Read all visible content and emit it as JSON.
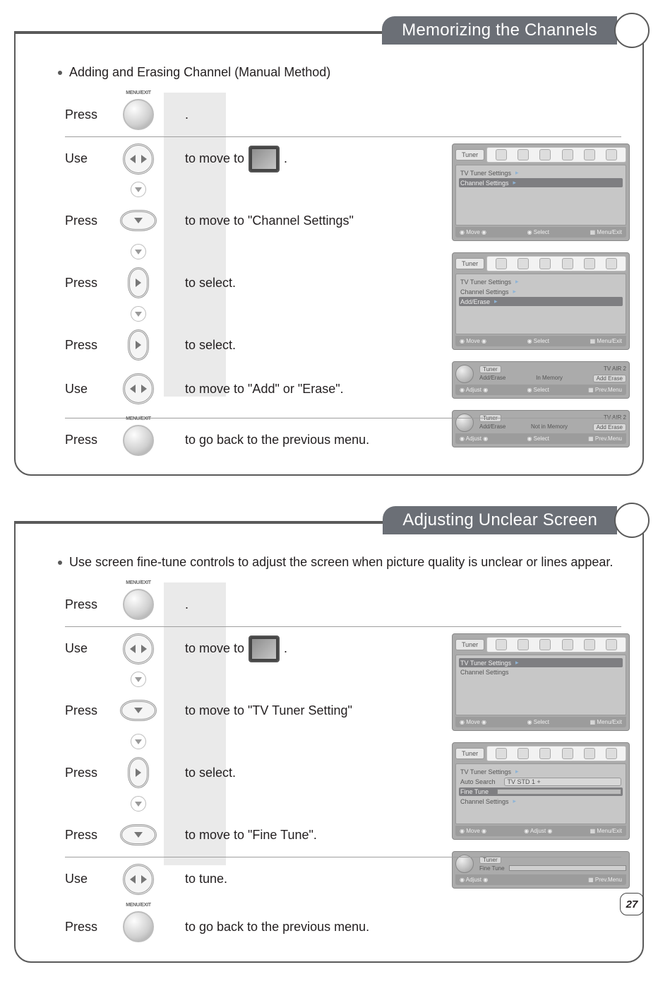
{
  "page_number": "27",
  "section1": {
    "header": "Memorizing the Channels",
    "title": "Adding and Erasing Channel (Manual Method)",
    "steps": [
      {
        "label": "Press",
        "after": "."
      },
      {
        "label": "Use",
        "after_pre": "to move to",
        "after_post": "."
      },
      {
        "label": "Press",
        "after": "to move to \"Channel Settings\""
      },
      {
        "label": "Press",
        "after": "to select."
      },
      {
        "label": "Press",
        "after": "to select."
      },
      {
        "label": "Use",
        "after": "to move to  \"Add\" or \"Erase\"."
      },
      {
        "label": "Press",
        "after": "to go back to the previous menu."
      }
    ],
    "osd": {
      "tab": "Tuner",
      "rows1": [
        "TV Tuner Settings",
        "Channel Settings"
      ],
      "rows2": [
        "TV Tuner Settings",
        "Channel Settings",
        "Add/Erase"
      ],
      "small1": {
        "left": "Add/Erase",
        "mid": "In Memory",
        "right": "Add       Erase",
        "header_l": "Tuner",
        "header_r": "TV AIR               2"
      },
      "small2": {
        "left": "Add/Erase",
        "mid": "Not in Memory",
        "right": "Add       Erase",
        "header_l": "Tuner",
        "header_r": "TV AIR               2"
      },
      "foot": {
        "a": "Move",
        "b": "Select",
        "c": "Menu/Exit"
      },
      "foot2": {
        "a": "Adjust",
        "b": "Select",
        "c": "Prev.Menu"
      }
    }
  },
  "section2": {
    "header": "Adjusting Unclear Screen",
    "title": "Use screen fine-tune controls to adjust the screen when picture quality is unclear or lines appear.",
    "steps": [
      {
        "label": "Press",
        "after": "."
      },
      {
        "label": "Use",
        "after_pre": "to move to",
        "after_post": "."
      },
      {
        "label": "Press",
        "after": "to move to \"TV Tuner Setting\""
      },
      {
        "label": "Press",
        "after": "to select."
      },
      {
        "label": "Press",
        "after": "to move to \"Fine Tune\"."
      },
      {
        "label": "Use",
        "after": "to tune."
      },
      {
        "label": "Press",
        "after": "to go back to the previous menu."
      }
    ],
    "osd": {
      "tab": "Tuner",
      "rows1": [
        "TV Tuner Settings",
        "Channel Settings"
      ],
      "rows2": [
        "TV Tuner Settings",
        "Auto Search",
        "Fine Tune",
        "Channel Settings"
      ],
      "rows2_val": "TV STD 1 +",
      "small": {
        "header_l": "Tuner",
        "row": "Fine Tune"
      },
      "foot": {
        "a": "Move",
        "b": "Select",
        "c": "Menu/Exit"
      },
      "foot_adj": {
        "a": "Move",
        "b": "Adjust",
        "c": "Menu/Exit"
      },
      "foot2": {
        "a": "Adjust",
        "c": "Prev.Menu"
      }
    }
  },
  "button_caption": "MENU/EXIT"
}
